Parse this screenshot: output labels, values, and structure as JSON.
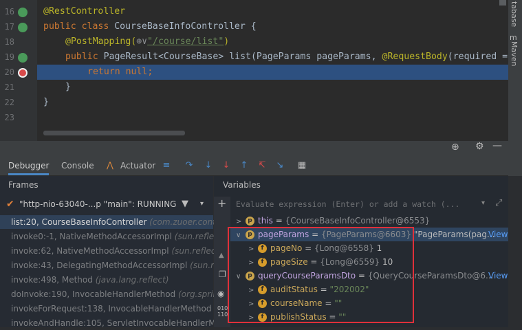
{
  "editor": {
    "line_numbers": [
      "16",
      "17",
      "18",
      "19",
      "20",
      "21",
      "22",
      "23"
    ],
    "lines": {
      "l16": "@RestController",
      "l17_kw": "public class ",
      "l17_rest": "CourseBaseInfoController {",
      "l18_ann": "@PostMapping(",
      "l18_url": "\"/course/list\"",
      "l18_end": ")",
      "l19_kw": "public ",
      "l19_rest": "PageResult<CourseBase> list(PageParams pageParams, ",
      "l19_ann": "@RequestBody",
      "l19_tail": "(required =",
      "l20_kw": "return null",
      "l20_end": ";",
      "l21": "}",
      "l22": "}"
    }
  },
  "side_tools": {
    "database": "tabase",
    "maven": "Maven"
  },
  "tabs": {
    "debugger": "Debugger",
    "console": "Console",
    "actuator": "Actuator"
  },
  "frames": {
    "header": "Frames",
    "thread": "\"http-nio-63040-...p \"main\": RUNNING",
    "rows": [
      {
        "method": "list:20, CourseBaseInfoController",
        "pkg": "(com.zuoer.conte"
      },
      {
        "method": "invoke0:-1, NativeMethodAccessorImpl",
        "pkg": "(sun.reflect)"
      },
      {
        "method": "invoke:62, NativeMethodAccessorImpl",
        "pkg": "(sun.reflect)"
      },
      {
        "method": "invoke:43, DelegatingMethodAccessorImpl",
        "pkg": "(sun.re"
      },
      {
        "method": "invoke:498, Method",
        "pkg": "(java.lang.reflect)"
      },
      {
        "method": "doInvoke:190, InvocableHandlerMethod",
        "pkg": "(org.sprin"
      },
      {
        "method": "invokeForRequest:138, InvocableHandlerMethod",
        "pkg": ""
      },
      {
        "method": "invokeAndHandle:105, ServletInvocableHandlerMe",
        "pkg": ""
      }
    ]
  },
  "variables": {
    "header": "Variables",
    "eval_placeholder": "Evaluate expression (Enter) or add a watch (...",
    "rows": [
      {
        "name": "this",
        "eq": " = ",
        "type": "{CourseBaseInfoController@6553}",
        "val": ""
      },
      {
        "name": "pageParams",
        "eq": " = ",
        "type": "{PageParams@6603} ",
        "val": "\"PageParams(pag...",
        "link": "View"
      },
      {
        "name": "pageNo",
        "eq": " = ",
        "type": "{Long@6558} ",
        "val": "1"
      },
      {
        "name": "pageSize",
        "eq": " = ",
        "type": "{Long@6559} ",
        "val": "10"
      },
      {
        "name": "queryCourseParamsDto",
        "eq": " = ",
        "type": "{QueryCourseParamsDto@6...",
        "val": "",
        "link": "View"
      },
      {
        "name": "auditStatus",
        "eq": " = ",
        "type": "",
        "val": "\"202002\""
      },
      {
        "name": "courseName",
        "eq": " = ",
        "type": "",
        "val": "\"\""
      },
      {
        "name": "publishStatus",
        "eq": " = ",
        "type": "",
        "val": "\"\""
      }
    ]
  },
  "colors": {
    "highlight": "#2d5080",
    "annotation_box": "#e0303a",
    "keyword": "#cc7832"
  }
}
